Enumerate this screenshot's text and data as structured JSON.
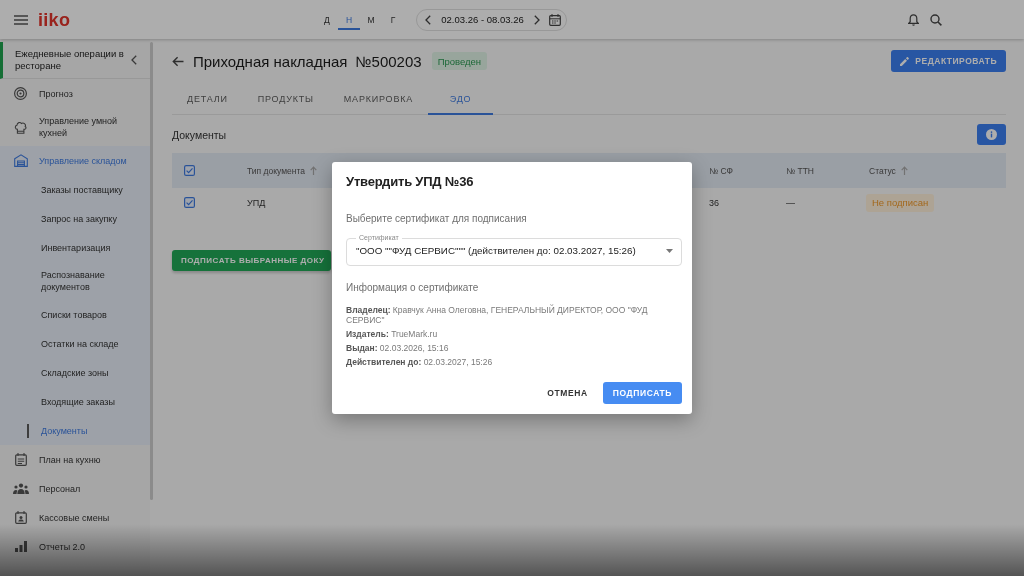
{
  "top_bar": {
    "logo": "iiko",
    "periods": [
      {
        "label": "Д",
        "selected": false
      },
      {
        "label": "Н",
        "selected": true
      },
      {
        "label": "М",
        "selected": false
      },
      {
        "label": "Г",
        "selected": false
      }
    ],
    "date_range": "02.03.26 - 08.03.26"
  },
  "sidebar": {
    "header": "Ежедневные операции в ресторане",
    "items": [
      {
        "label": "Прогноз",
        "selected": false
      },
      {
        "label": "Управление умной кухней",
        "selected": false
      },
      {
        "label": "Управление складом",
        "selected": true,
        "children": [
          {
            "label": "Заказы поставщику",
            "selected": false
          },
          {
            "label": "Запрос на закупку",
            "selected": false
          },
          {
            "label": "Инвентаризация",
            "selected": false
          },
          {
            "label": "Распознавание документов",
            "selected": false
          },
          {
            "label": "Списки товаров",
            "selected": false
          },
          {
            "label": "Остатки на складе",
            "selected": false
          },
          {
            "label": "Складские зоны",
            "selected": false
          },
          {
            "label": "Входящие заказы",
            "selected": false
          },
          {
            "label": "Документы",
            "selected": true
          }
        ]
      },
      {
        "label": "План на кухню",
        "selected": false
      },
      {
        "label": "Персонал",
        "selected": false
      },
      {
        "label": "Кассовые смены",
        "selected": false
      },
      {
        "label": "Отчеты 2.0",
        "selected": false
      }
    ]
  },
  "page": {
    "title": "Приходная накладная",
    "number": "№500203",
    "status": {
      "label": "Проведен",
      "kind": "done"
    },
    "edit_button": "РЕДАКТИРОВАТЬ",
    "tabs": [
      {
        "label": "ДЕТАЛИ",
        "selected": false
      },
      {
        "label": "ПРОДУКТЫ",
        "selected": false
      },
      {
        "label": "МАРКИРОВКА",
        "selected": false
      },
      {
        "label": "ЭДО",
        "selected": true
      }
    ],
    "section_title": "Документы",
    "table": {
      "all_checked": true,
      "columns": [
        {
          "label": "Тип документа",
          "sorted": true
        },
        {
          "label": "№ СФ",
          "sorted": false
        },
        {
          "label": "№ ТТН",
          "sorted": false
        },
        {
          "label": "Статус",
          "sorted": true
        }
      ],
      "rows": [
        {
          "checked": true,
          "cells": [
            "УПД",
            "36",
            "—"
          ],
          "status": {
            "label": "Не подписан",
            "kind": "pending"
          }
        }
      ]
    },
    "sign_button": "ПОДПИСАТЬ ВЫБРАННЫЕ ДОКУ"
  },
  "dialog": {
    "title": "Утвердить УПД №36",
    "prompt": "Выберите сертификат для подписания",
    "certificate_field": {
      "label": "Сертификат",
      "value": "\"ООО \"\"ФУД СЕРВИС\"\"\" (действителен до: 02.03.2027, 15:26)"
    },
    "info_title": "Информация о сертификате",
    "info": [
      "**Владелец:** Кравчук Анна Олеговна, ГЕНЕРАЛЬНЫЙ ДИРЕКТОР, ООО \"ФУД СЕРВИС\"",
      "**Издатель:** TrueMark.ru",
      "**Выдан:** 02.03.2026, 15:16",
      "**Действителен до:** 02.03.2027, 15:26"
    ],
    "buttons": [
      {
        "label": "ОТМЕНА",
        "kind": "text"
      },
      {
        "label": "ПОДПИСАТЬ",
        "kind": "primary"
      }
    ]
  }
}
